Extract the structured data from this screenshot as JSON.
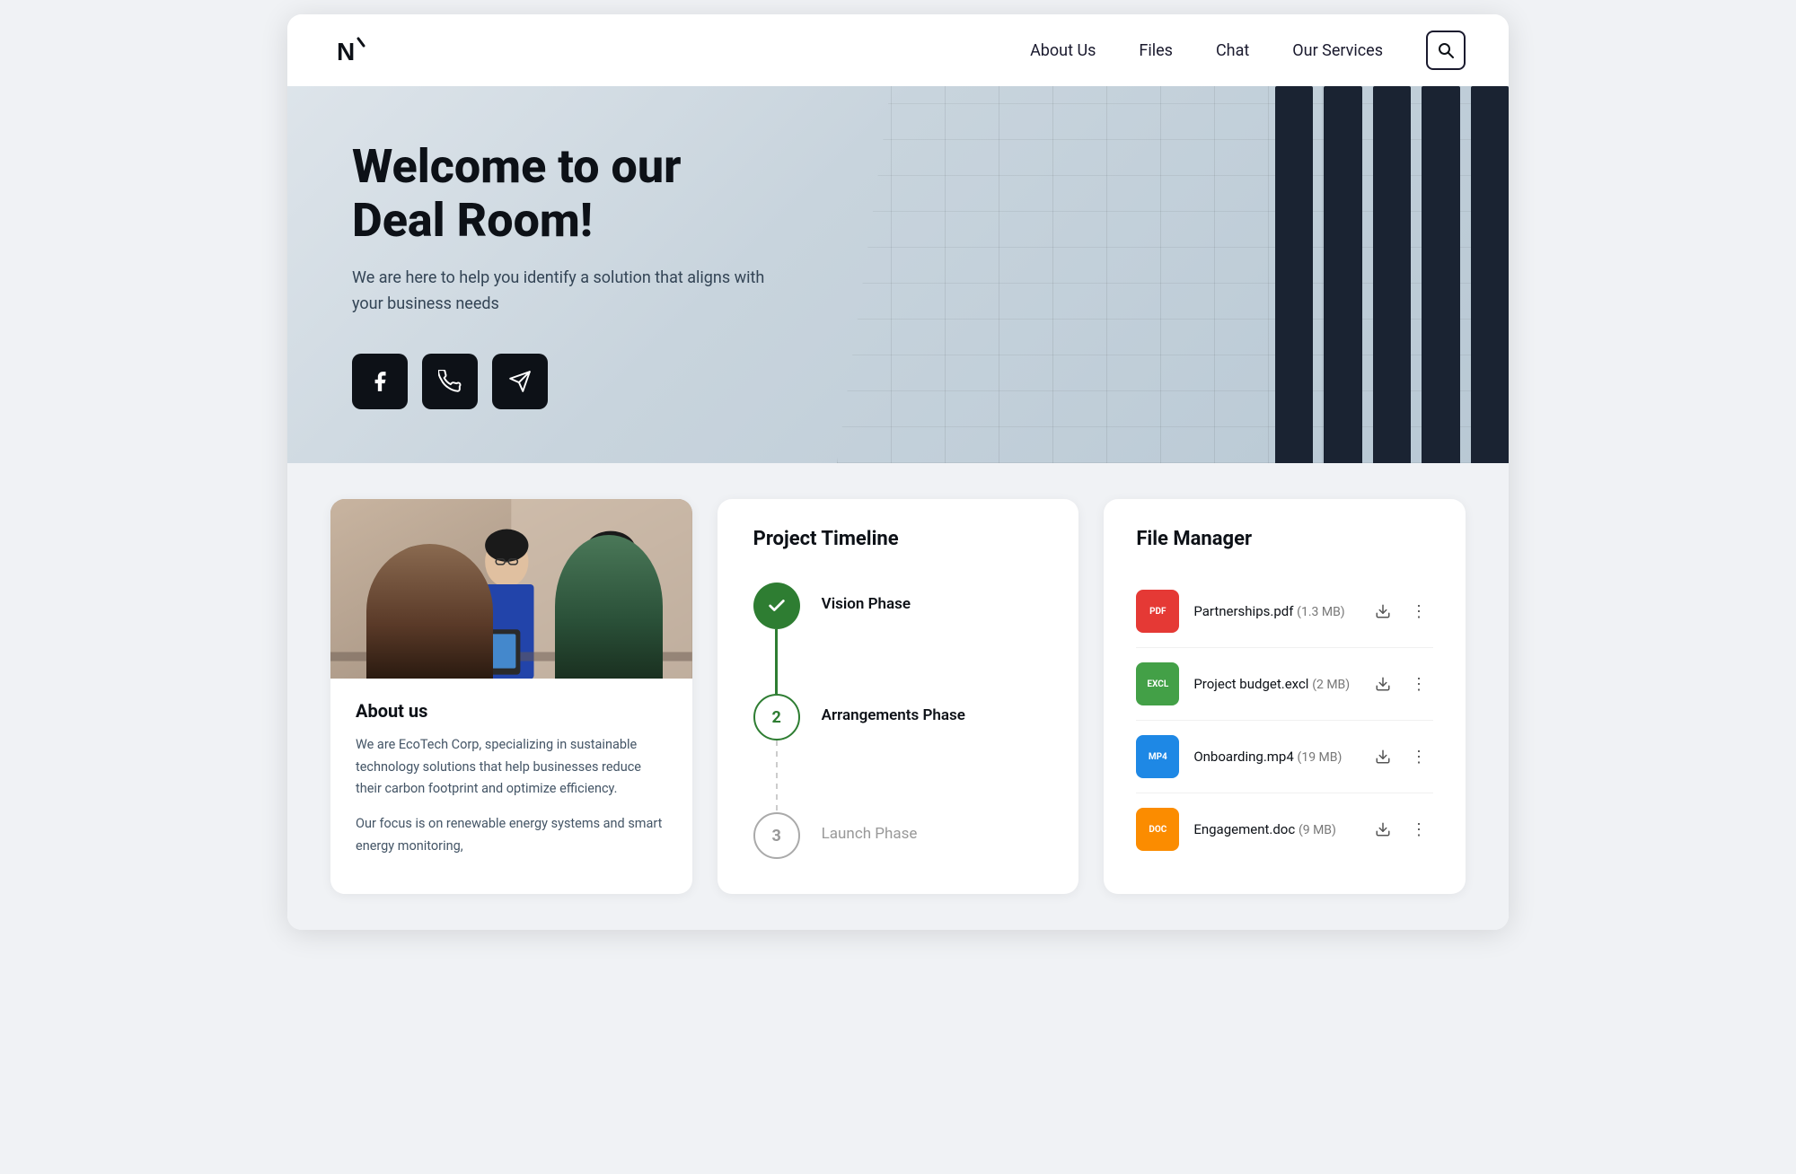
{
  "navbar": {
    "logo_text": "N",
    "links": [
      {
        "id": "about-us",
        "label": "About Us"
      },
      {
        "id": "files",
        "label": "Files"
      },
      {
        "id": "chat",
        "label": "Chat"
      },
      {
        "id": "our-services",
        "label": "Our Services"
      }
    ],
    "search_aria": "Search"
  },
  "hero": {
    "title": "Welcome to our Deal Room!",
    "subtitle": "We are here to help you identify a solution that aligns with your business needs",
    "social_buttons": [
      {
        "id": "facebook",
        "icon": "f",
        "aria": "Facebook"
      },
      {
        "id": "whatsapp",
        "icon": "phone",
        "aria": "WhatsApp"
      },
      {
        "id": "telegram",
        "icon": "send",
        "aria": "Telegram"
      }
    ]
  },
  "about_card": {
    "title": "About us",
    "paragraphs": [
      "We are EcoTech Corp, specializing in sustainable technology solutions that help businesses reduce their carbon footprint and optimize efficiency.",
      "Our focus is on renewable energy systems and smart energy monitoring,"
    ]
  },
  "timeline_card": {
    "title": "Project Timeline",
    "items": [
      {
        "id": "vision",
        "label": "Vision Phase",
        "state": "completed",
        "number": "✓"
      },
      {
        "id": "arrangements",
        "label": "Arrangements Phase",
        "state": "active",
        "number": "2"
      },
      {
        "id": "launch",
        "label": "Launch Phase",
        "state": "inactive",
        "number": "3"
      }
    ]
  },
  "file_manager_card": {
    "title": "File Manager",
    "files": [
      {
        "id": "partnerships-pdf",
        "badge": "PDF",
        "badge_class": "badge-pdf",
        "name": "Partnerships.pdf",
        "size": "(1.3 MB)"
      },
      {
        "id": "project-budget-excl",
        "badge": "EXCL",
        "badge_class": "badge-excl",
        "name": "Project budget.excl",
        "size": "(2 MB)"
      },
      {
        "id": "onboarding-mp4",
        "badge": "MP4",
        "badge_class": "badge-mp4",
        "name": "Onboarding.mp4",
        "size": "(19 MB)"
      },
      {
        "id": "engagement-doc",
        "badge": "DOC",
        "badge_class": "badge-doc",
        "name": "Engagement.doc",
        "size": "(9 MB)"
      }
    ]
  }
}
